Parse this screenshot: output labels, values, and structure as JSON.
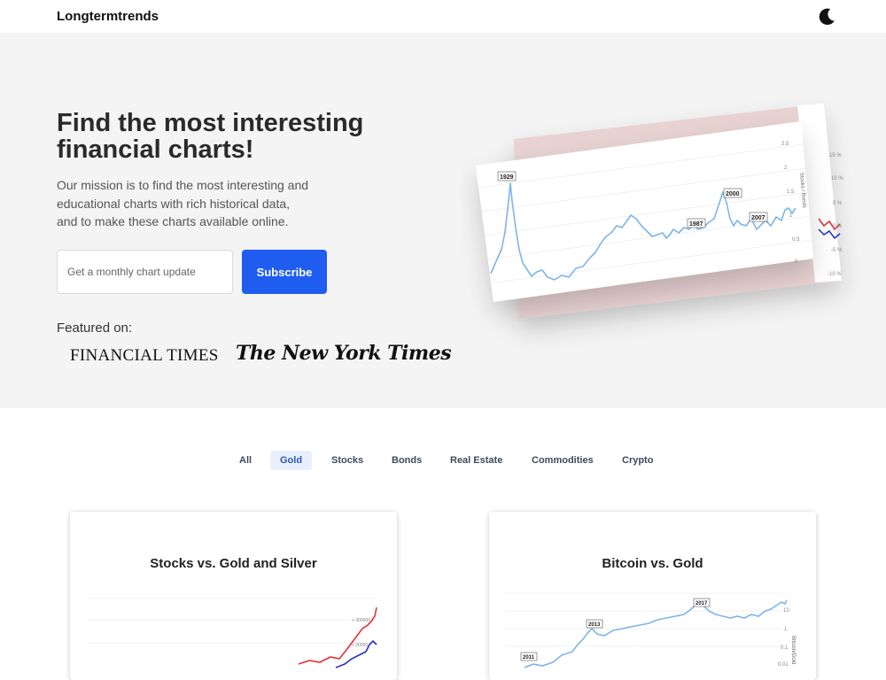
{
  "header": {
    "brand": "Longtermtrends",
    "theme_toggle_icon": "moon-icon"
  },
  "hero": {
    "headline_line1": "Find the most interesting",
    "headline_line2": "financial charts!",
    "mission_line1": "Our mission is to find the most interesting and",
    "mission_line2": "educational charts with rich historical data,",
    "mission_line3": "and to make these charts available online.",
    "email_placeholder": "Get a monthly chart update",
    "subscribe_label": "Subscribe",
    "featured_label": "Featured on:",
    "featured": [
      "FINANCIAL TIMES",
      "The New York Times"
    ],
    "chart_preview": {
      "annotations": [
        "1929",
        "1987",
        "2000",
        "2007"
      ],
      "right_axis_ticks": [
        "2.5",
        "2",
        "1.5",
        "1",
        "0.5",
        "0"
      ],
      "right_axis_label": "Stocks / Bonds",
      "back_axis_ticks": [
        "15 %",
        "10 %",
        "5 %",
        "0 %",
        "-5 %",
        "-10 %"
      ]
    }
  },
  "filters": {
    "items": [
      "All",
      "Gold",
      "Stocks",
      "Bonds",
      "Real Estate",
      "Commodities",
      "Crypto"
    ],
    "active": "Gold"
  },
  "cards": [
    {
      "title": "Stocks vs. Gold and Silver",
      "axis_ticks": [
        "+ 300000",
        "+ 30000"
      ]
    },
    {
      "title": "Bitcoin vs. Gold",
      "annotations": [
        "2011",
        "2013",
        "2017"
      ],
      "axis_ticks": [
        "10",
        "1",
        "0.1",
        "0.01"
      ],
      "axis_label": "Bitcoin/Gold"
    }
  ],
  "colors": {
    "accent": "#1f5df0",
    "hero_bg": "#f4f4f5",
    "filter_active_bg": "#e9f0fd",
    "chart_line": "#7eb4e8"
  }
}
